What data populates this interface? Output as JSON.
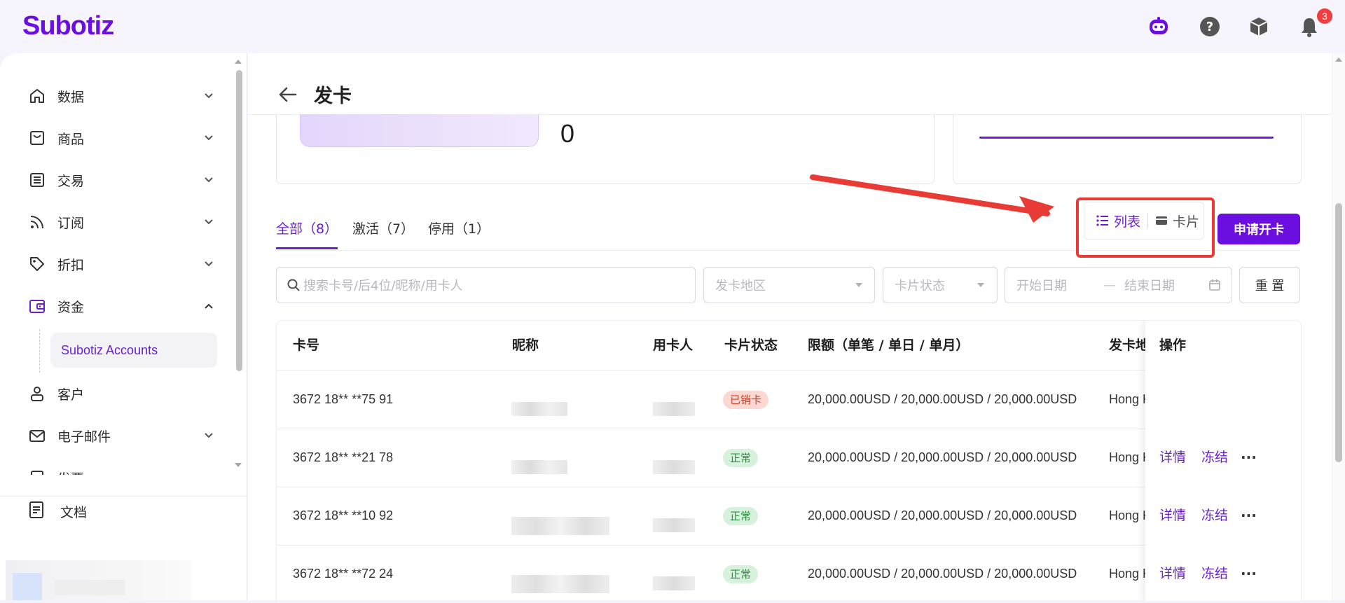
{
  "brand": {
    "logo": "Subotiz",
    "accent": "#6a0fe0"
  },
  "topbar": {
    "notification_count": "3",
    "icons": [
      "assistant-bot-icon",
      "help-icon",
      "package-icon",
      "bell-icon"
    ]
  },
  "sidebar": {
    "items": [
      {
        "label": "数据",
        "icon": "home-icon"
      },
      {
        "label": "商品",
        "icon": "store-icon"
      },
      {
        "label": "交易",
        "icon": "list-icon"
      },
      {
        "label": "订阅",
        "icon": "rss-icon"
      },
      {
        "label": "折扣",
        "icon": "tag-icon"
      },
      {
        "label": "资金",
        "icon": "wallet-icon"
      },
      {
        "label": "客户",
        "icon": "user-icon"
      },
      {
        "label": "电子邮件",
        "icon": "mail-icon"
      },
      {
        "label": "发票",
        "icon": "invoice-icon"
      }
    ],
    "sub_item": "Subotiz Accounts",
    "docs": "文档"
  },
  "page": {
    "title": "发卡",
    "summary_count": "0"
  },
  "tabs": [
    {
      "label": "全部（8）",
      "active": true
    },
    {
      "label": "激活（7）",
      "active": false
    },
    {
      "label": "停用（1）",
      "active": false
    }
  ],
  "view_toggle": {
    "list": "列表",
    "card": "卡片",
    "active": "list"
  },
  "apply_button": "申请开卡",
  "filters": {
    "search_placeholder": "搜索卡号/后4位/昵称/用卡人",
    "region_placeholder": "发卡地区",
    "status_placeholder": "卡片状态",
    "start_date": "开始日期",
    "date_separator": "—",
    "end_date": "结束日期",
    "reset": "重 置"
  },
  "table": {
    "columns": [
      "卡号",
      "昵称",
      "用卡人",
      "卡片状态",
      "限额（单笔 / 单日 / 单月）",
      "发卡地",
      "操作"
    ],
    "rows": [
      {
        "card_no": "3672 18** **75 91",
        "status": "已销卡",
        "status_type": "cancel",
        "limit": "20,000.00USD / 20,000.00USD / 20,000.00USD",
        "region": "Hong K",
        "ops": []
      },
      {
        "card_no": "3672 18** **21 78",
        "status": "正常",
        "status_type": "ok",
        "limit": "20,000.00USD / 20,000.00USD / 20,000.00USD",
        "region": "Hong K",
        "ops": [
          "详情",
          "冻结"
        ]
      },
      {
        "card_no": "3672 18** **10 92",
        "status": "正常",
        "status_type": "ok",
        "limit": "20,000.00USD / 20,000.00USD / 20,000.00USD",
        "region": "Hong K",
        "ops": [
          "详情",
          "冻结"
        ]
      },
      {
        "card_no": "3672 18** **72 24",
        "status": "正常",
        "status_type": "ok",
        "limit": "20,000.00USD / 20,000.00USD / 20,000.00USD",
        "region": "Hong K",
        "ops": [
          "详情",
          "冻结"
        ]
      }
    ]
  },
  "colors": {
    "status_cancel_bg": "#fbd9d2",
    "status_ok_bg": "#d6f1dc",
    "annotation_red": "#e83b35"
  }
}
